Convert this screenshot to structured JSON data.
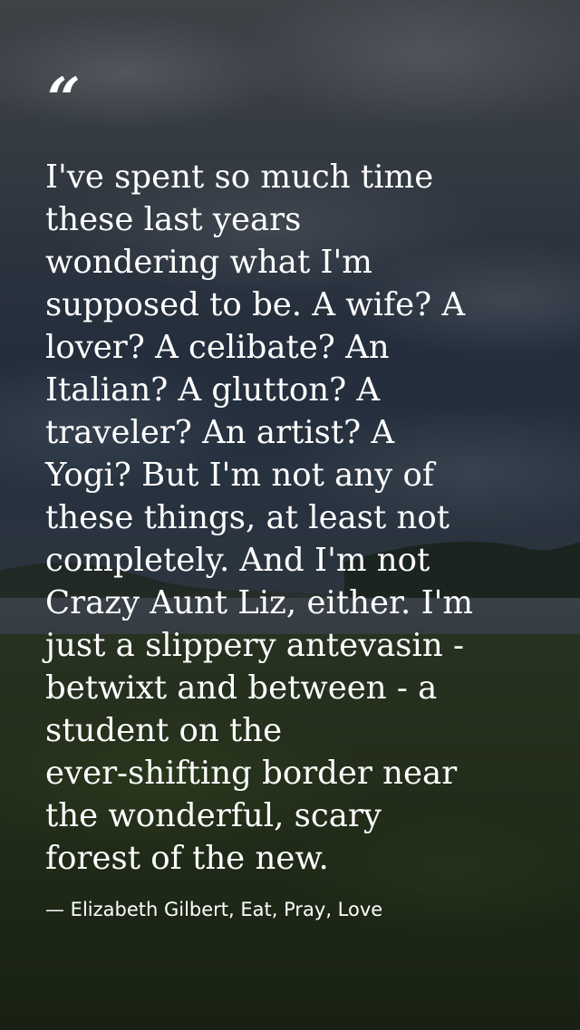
{
  "quote": {
    "mark": "“",
    "text": "I've spent so much time\nthese last years\nwondering what I'm\nsupposed to be. A wife? A\nlover? A celibate? An\nItalian? A glutton? A\ntraveler? An artist? A\nYogi? But I'm not any of\nthese things, at least not\ncompletely. And I'm not\nCrazy Aunt Liz, either. I'm\njust a slippery antevasin -\nbetwixt and between - a\nstudent on the\never-shifting border near\nthe wonderful, scary\nforest of the new.",
    "attribution": "— Elizabeth Gilbert, Eat, Pray, Love"
  },
  "background": {
    "scene": "cloudy-sky-lake-grass-field",
    "sky_color": "#3f4c5c",
    "grass_color": "#2e3d23",
    "text_color": "#ffffff"
  }
}
